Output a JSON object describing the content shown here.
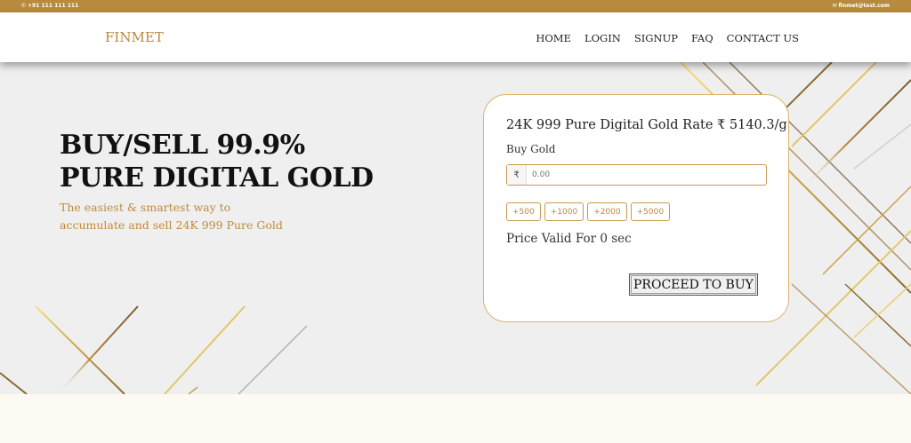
{
  "topbar": {
    "phone": "+91 111 111 111",
    "email": "finmet@test.com",
    "phone_icon": "phone-icon",
    "email_icon": "envelope-icon",
    "bg_color": "#b88a3e"
  },
  "navbar": {
    "brand": "FINMET",
    "items": [
      "HOME",
      "LOGIN",
      "SIGNUP",
      "FAQ",
      "CONTACT US"
    ]
  },
  "hero": {
    "headline_line1": "BUY/SELL 99.9%",
    "headline_line2": "PURE DIGITAL GOLD",
    "subtitle_line1": "The easiest & smartest way to",
    "subtitle_line2": "accumulate and sell 24K 999 Pure Gold"
  },
  "card": {
    "rate_text": "24K 999 Pure Digital Gold Rate ₹ 5140.3/g",
    "buy_label": "Buy Gold",
    "currency_symbol": "₹",
    "amount_placeholder": "0.00",
    "chips": [
      "+500",
      "+1000",
      "+2000",
      "+5000"
    ],
    "validity_text": "Price Valid For 0 sec",
    "proceed_label": "PROCEED TO BUY"
  },
  "colors": {
    "accent": "#b88a3e",
    "hero_bg": "#efefef",
    "page_bg": "#fdf9f3"
  }
}
